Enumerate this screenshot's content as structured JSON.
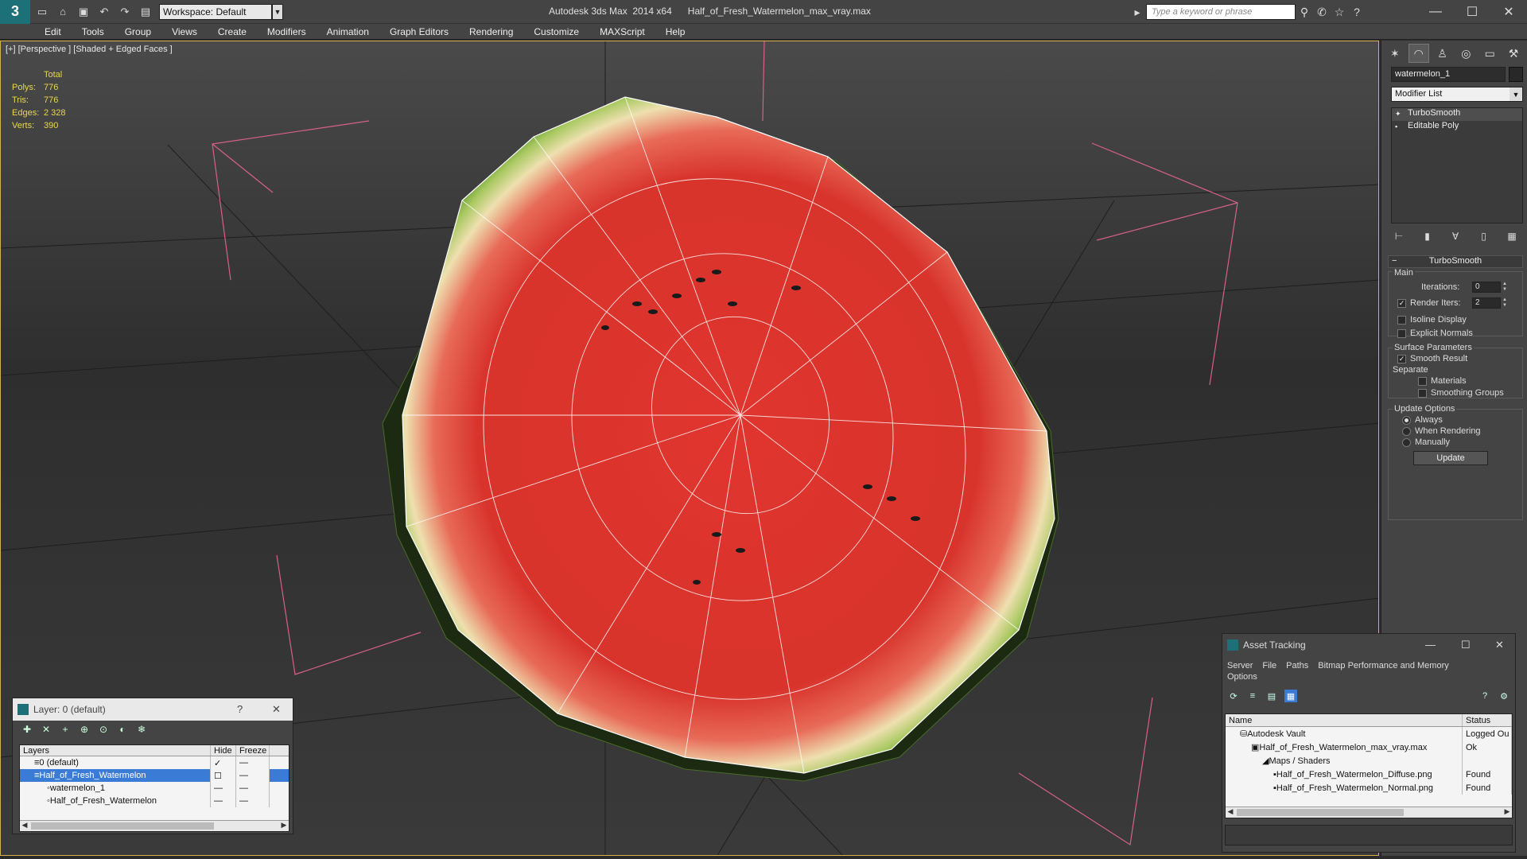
{
  "titlebar": {
    "workspace": "Workspace: Default",
    "app_title": "Autodesk 3ds Max  2014 x64",
    "file_title": "Half_of_Fresh_Watermelon_max_vray.max",
    "search_placeholder": "Type a keyword or phrase"
  },
  "menu": [
    "Edit",
    "Tools",
    "Group",
    "Views",
    "Create",
    "Modifiers",
    "Animation",
    "Graph Editors",
    "Rendering",
    "Customize",
    "MAXScript",
    "Help"
  ],
  "viewport": {
    "label": "[+] [Perspective ] [Shaded + Edged Faces ]",
    "stats": {
      "header": "Total",
      "rows": [
        {
          "label": "Polys:",
          "value": "776"
        },
        {
          "label": "Tris:",
          "value": "776"
        },
        {
          "label": "Edges:",
          "value": "2 328"
        },
        {
          "label": "Verts:",
          "value": "390"
        }
      ]
    }
  },
  "command_panel": {
    "object_name": "watermelon_1",
    "modifier_list": "Modifier List",
    "stack": [
      "TurboSmooth",
      "Editable Poly"
    ],
    "rollout_title": "TurboSmooth",
    "main_label": "Main",
    "iterations_label": "Iterations:",
    "iterations_value": "0",
    "render_iters_label": "Render Iters:",
    "render_iters_value": "2",
    "isoline_label": "Isoline Display",
    "explicit_label": "Explicit Normals",
    "surface_label": "Surface Parameters",
    "smooth_result_label": "Smooth Result",
    "separate_label": "Separate",
    "materials_label": "Materials",
    "smoothing_groups_label": "Smoothing Groups",
    "update_options_label": "Update Options",
    "always_label": "Always",
    "when_rendering_label": "When Rendering",
    "manually_label": "Manually",
    "update_button": "Update"
  },
  "layer_panel": {
    "title": "Layer: 0 (default)",
    "help": "?",
    "columns": [
      "Layers",
      "Hide",
      "Freeze"
    ],
    "rows": [
      {
        "name": "0 (default)",
        "check": "✓"
      },
      {
        "name": "Half_of_Fresh_Watermelon",
        "check": ""
      },
      {
        "name": "watermelon_1",
        "check": ""
      },
      {
        "name": "Half_of_Fresh_Watermelon",
        "check": ""
      }
    ]
  },
  "asset_panel": {
    "title": "Asset Tracking",
    "menu": [
      "Server",
      "File",
      "Paths",
      "Bitmap Performance and Memory"
    ],
    "menu2": "Options",
    "columns": [
      "Name",
      "Status"
    ],
    "rows": [
      {
        "name": "Autodesk Vault",
        "status": "Logged Ou"
      },
      {
        "name": "Half_of_Fresh_Watermelon_max_vray.max",
        "status": "Ok"
      },
      {
        "name": "Maps / Shaders",
        "status": ""
      },
      {
        "name": "Half_of_Fresh_Watermelon_Diffuse.png",
        "status": "Found"
      },
      {
        "name": "Half_of_Fresh_Watermelon_Normal.png",
        "status": "Found"
      }
    ]
  },
  "colors": {
    "accent": "#3a7bd5",
    "viewport_border": "#d6b24a",
    "stats": "#e8d84a",
    "gizmo": "#d6608a"
  }
}
